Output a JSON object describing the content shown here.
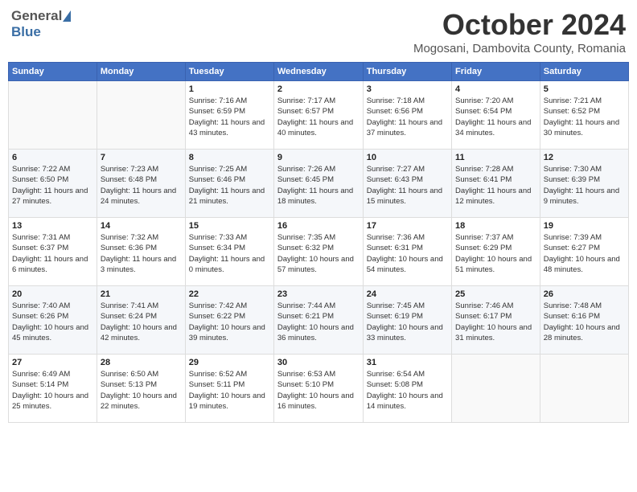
{
  "header": {
    "logo_general": "General",
    "logo_blue": "Blue",
    "month_title": "October 2024",
    "location": "Mogosani, Dambovita County, Romania"
  },
  "days_of_week": [
    "Sunday",
    "Monday",
    "Tuesday",
    "Wednesday",
    "Thursday",
    "Friday",
    "Saturday"
  ],
  "weeks": [
    [
      {
        "day": "",
        "sunrise": "",
        "sunset": "",
        "daylight": ""
      },
      {
        "day": "",
        "sunrise": "",
        "sunset": "",
        "daylight": ""
      },
      {
        "day": "1",
        "sunrise": "Sunrise: 7:16 AM",
        "sunset": "Sunset: 6:59 PM",
        "daylight": "Daylight: 11 hours and 43 minutes."
      },
      {
        "day": "2",
        "sunrise": "Sunrise: 7:17 AM",
        "sunset": "Sunset: 6:57 PM",
        "daylight": "Daylight: 11 hours and 40 minutes."
      },
      {
        "day": "3",
        "sunrise": "Sunrise: 7:18 AM",
        "sunset": "Sunset: 6:56 PM",
        "daylight": "Daylight: 11 hours and 37 minutes."
      },
      {
        "day": "4",
        "sunrise": "Sunrise: 7:20 AM",
        "sunset": "Sunset: 6:54 PM",
        "daylight": "Daylight: 11 hours and 34 minutes."
      },
      {
        "day": "5",
        "sunrise": "Sunrise: 7:21 AM",
        "sunset": "Sunset: 6:52 PM",
        "daylight": "Daylight: 11 hours and 30 minutes."
      }
    ],
    [
      {
        "day": "6",
        "sunrise": "Sunrise: 7:22 AM",
        "sunset": "Sunset: 6:50 PM",
        "daylight": "Daylight: 11 hours and 27 minutes."
      },
      {
        "day": "7",
        "sunrise": "Sunrise: 7:23 AM",
        "sunset": "Sunset: 6:48 PM",
        "daylight": "Daylight: 11 hours and 24 minutes."
      },
      {
        "day": "8",
        "sunrise": "Sunrise: 7:25 AM",
        "sunset": "Sunset: 6:46 PM",
        "daylight": "Daylight: 11 hours and 21 minutes."
      },
      {
        "day": "9",
        "sunrise": "Sunrise: 7:26 AM",
        "sunset": "Sunset: 6:45 PM",
        "daylight": "Daylight: 11 hours and 18 minutes."
      },
      {
        "day": "10",
        "sunrise": "Sunrise: 7:27 AM",
        "sunset": "Sunset: 6:43 PM",
        "daylight": "Daylight: 11 hours and 15 minutes."
      },
      {
        "day": "11",
        "sunrise": "Sunrise: 7:28 AM",
        "sunset": "Sunset: 6:41 PM",
        "daylight": "Daylight: 11 hours and 12 minutes."
      },
      {
        "day": "12",
        "sunrise": "Sunrise: 7:30 AM",
        "sunset": "Sunset: 6:39 PM",
        "daylight": "Daylight: 11 hours and 9 minutes."
      }
    ],
    [
      {
        "day": "13",
        "sunrise": "Sunrise: 7:31 AM",
        "sunset": "Sunset: 6:37 PM",
        "daylight": "Daylight: 11 hours and 6 minutes."
      },
      {
        "day": "14",
        "sunrise": "Sunrise: 7:32 AM",
        "sunset": "Sunset: 6:36 PM",
        "daylight": "Daylight: 11 hours and 3 minutes."
      },
      {
        "day": "15",
        "sunrise": "Sunrise: 7:33 AM",
        "sunset": "Sunset: 6:34 PM",
        "daylight": "Daylight: 11 hours and 0 minutes."
      },
      {
        "day": "16",
        "sunrise": "Sunrise: 7:35 AM",
        "sunset": "Sunset: 6:32 PM",
        "daylight": "Daylight: 10 hours and 57 minutes."
      },
      {
        "day": "17",
        "sunrise": "Sunrise: 7:36 AM",
        "sunset": "Sunset: 6:31 PM",
        "daylight": "Daylight: 10 hours and 54 minutes."
      },
      {
        "day": "18",
        "sunrise": "Sunrise: 7:37 AM",
        "sunset": "Sunset: 6:29 PM",
        "daylight": "Daylight: 10 hours and 51 minutes."
      },
      {
        "day": "19",
        "sunrise": "Sunrise: 7:39 AM",
        "sunset": "Sunset: 6:27 PM",
        "daylight": "Daylight: 10 hours and 48 minutes."
      }
    ],
    [
      {
        "day": "20",
        "sunrise": "Sunrise: 7:40 AM",
        "sunset": "Sunset: 6:26 PM",
        "daylight": "Daylight: 10 hours and 45 minutes."
      },
      {
        "day": "21",
        "sunrise": "Sunrise: 7:41 AM",
        "sunset": "Sunset: 6:24 PM",
        "daylight": "Daylight: 10 hours and 42 minutes."
      },
      {
        "day": "22",
        "sunrise": "Sunrise: 7:42 AM",
        "sunset": "Sunset: 6:22 PM",
        "daylight": "Daylight: 10 hours and 39 minutes."
      },
      {
        "day": "23",
        "sunrise": "Sunrise: 7:44 AM",
        "sunset": "Sunset: 6:21 PM",
        "daylight": "Daylight: 10 hours and 36 minutes."
      },
      {
        "day": "24",
        "sunrise": "Sunrise: 7:45 AM",
        "sunset": "Sunset: 6:19 PM",
        "daylight": "Daylight: 10 hours and 33 minutes."
      },
      {
        "day": "25",
        "sunrise": "Sunrise: 7:46 AM",
        "sunset": "Sunset: 6:17 PM",
        "daylight": "Daylight: 10 hours and 31 minutes."
      },
      {
        "day": "26",
        "sunrise": "Sunrise: 7:48 AM",
        "sunset": "Sunset: 6:16 PM",
        "daylight": "Daylight: 10 hours and 28 minutes."
      }
    ],
    [
      {
        "day": "27",
        "sunrise": "Sunrise: 6:49 AM",
        "sunset": "Sunset: 5:14 PM",
        "daylight": "Daylight: 10 hours and 25 minutes."
      },
      {
        "day": "28",
        "sunrise": "Sunrise: 6:50 AM",
        "sunset": "Sunset: 5:13 PM",
        "daylight": "Daylight: 10 hours and 22 minutes."
      },
      {
        "day": "29",
        "sunrise": "Sunrise: 6:52 AM",
        "sunset": "Sunset: 5:11 PM",
        "daylight": "Daylight: 10 hours and 19 minutes."
      },
      {
        "day": "30",
        "sunrise": "Sunrise: 6:53 AM",
        "sunset": "Sunset: 5:10 PM",
        "daylight": "Daylight: 10 hours and 16 minutes."
      },
      {
        "day": "31",
        "sunrise": "Sunrise: 6:54 AM",
        "sunset": "Sunset: 5:08 PM",
        "daylight": "Daylight: 10 hours and 14 minutes."
      },
      {
        "day": "",
        "sunrise": "",
        "sunset": "",
        "daylight": ""
      },
      {
        "day": "",
        "sunrise": "",
        "sunset": "",
        "daylight": ""
      }
    ]
  ]
}
